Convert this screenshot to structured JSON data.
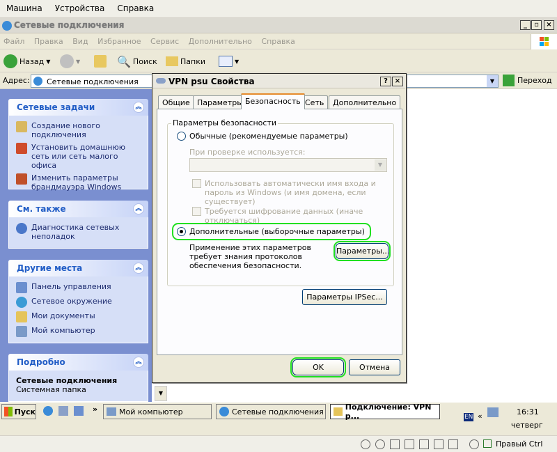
{
  "host_menu": [
    "Машина",
    "Устройства",
    "Справка"
  ],
  "explorer": {
    "title": "Сетевые подключения",
    "menu": [
      "Файл",
      "Правка",
      "Вид",
      "Избранное",
      "Сервис",
      "Дополнительно",
      "Справка"
    ],
    "toolbar": {
      "back": "Назад",
      "search": "Поиск",
      "folders": "Папки"
    },
    "address_label": "Адрес:",
    "address_value": "Сетевые подключения",
    "go_label": "Переход"
  },
  "tasks": {
    "network_tasks": {
      "title": "Сетевые задачи",
      "items": [
        "Создание нового подключения",
        "Установить домашнюю сеть или сеть малого офиса",
        "Изменить параметры брандмауэра Windows"
      ]
    },
    "see_also": {
      "title": "См. также",
      "items": [
        "Диагностика сетевых неполадок"
      ]
    },
    "other_places": {
      "title": "Другие места",
      "items": [
        "Панель управления",
        "Сетевое окружение",
        "Мои документы",
        "Мой компьютер"
      ]
    },
    "details": {
      "title": "Подробно",
      "name": "Сетевые подключения",
      "desc": "Системная папка"
    }
  },
  "dialog": {
    "title": "VPN psu Свойства",
    "tabs": [
      "Общие",
      "Параметры",
      "Безопасность",
      "Сеть",
      "Дополнительно"
    ],
    "group_label": "Параметры безопасности",
    "radio_typical": "Обычные (рекомендуемые параметры)",
    "verify_label": "При проверке используется:",
    "auto_login": "Использовать автоматически имя входа и пароль из Windows (и имя домена, если существует)",
    "require_encryption": "Требуется шифрование данных (иначе отключаться)",
    "radio_advanced": "Дополнительные (выборочные параметры)",
    "advanced_desc": "Применение этих параметров требует знания протоколов обеспечения безопасности.",
    "settings_btn": "Параметры...",
    "ipsec_btn": "Параметры IPSec...",
    "ok": "OK",
    "cancel": "Отмена"
  },
  "taskbar": {
    "start": "Пуск",
    "tasks": [
      "Мой компьютер",
      "Сетевые подключения",
      "Подключение: VPN p..."
    ],
    "lang": "EN",
    "time": "16:31",
    "day": "четверг"
  },
  "host_status": {
    "hostkey": "Правый Ctrl"
  }
}
